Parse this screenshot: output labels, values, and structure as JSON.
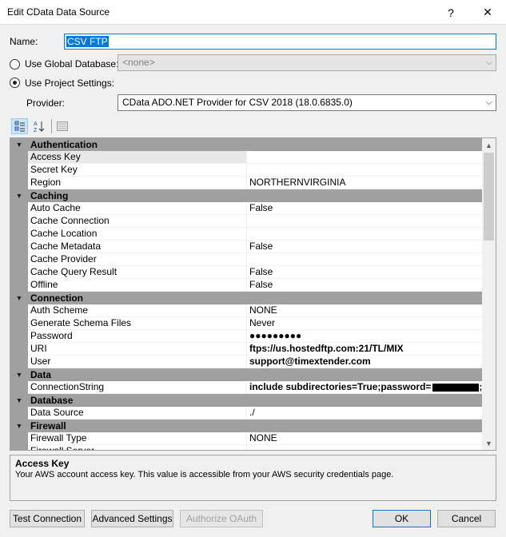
{
  "window": {
    "title": "Edit CData Data Source",
    "help_glyph": "?",
    "close_glyph": "✕"
  },
  "form": {
    "name_label": "Name:",
    "name_value": "CSV FTP",
    "use_global_label": "Use Global Database:",
    "global_db_value": "<none>",
    "use_project_label": "Use Project Settings:",
    "provider_label": "Provider:",
    "provider_value": "CData ADO.NET Provider for CSV 2018 (18.0.6835.0)",
    "selected_mode": "project"
  },
  "toolbar": {
    "categorized_icon": "categorized-icon",
    "alphabetical_icon": "alphabetical-icon",
    "property_pages_icon": "property-pages-icon"
  },
  "property_grid": {
    "categories": [
      {
        "name": "Authentication",
        "properties": [
          {
            "name": "Access Key",
            "value": "",
            "selected": true
          },
          {
            "name": "Secret Key",
            "value": ""
          },
          {
            "name": "Region",
            "value": "NORTHERNVIRGINIA"
          }
        ]
      },
      {
        "name": "Caching",
        "properties": [
          {
            "name": "Auto Cache",
            "value": "False"
          },
          {
            "name": "Cache Connection",
            "value": ""
          },
          {
            "name": "Cache Location",
            "value": ""
          },
          {
            "name": "Cache Metadata",
            "value": "False"
          },
          {
            "name": "Cache Provider",
            "value": ""
          },
          {
            "name": "Cache Query Result",
            "value": "False"
          },
          {
            "name": "Offline",
            "value": "False"
          }
        ]
      },
      {
        "name": "Connection",
        "properties": [
          {
            "name": "Auth Scheme",
            "value": "NONE"
          },
          {
            "name": "Generate Schema Files",
            "value": "Never"
          },
          {
            "name": "Password",
            "value": "●●●●●●●●●",
            "bold": true
          },
          {
            "name": "URI",
            "value": "ftps://us.hostedftp.com:21/TL/MIX",
            "bold": true
          },
          {
            "name": "User",
            "value": "support@timextender.com",
            "bold": true
          }
        ]
      },
      {
        "name": "Data",
        "properties": [
          {
            "name": "ConnectionString",
            "value": "include subdirectories=True;password=",
            "value_suffix": ";u",
            "bold": true,
            "redacted": true
          }
        ]
      },
      {
        "name": "Database",
        "properties": [
          {
            "name": "Data Source",
            "value": "./"
          }
        ]
      },
      {
        "name": "Firewall",
        "properties": [
          {
            "name": "Firewall Type",
            "value": "NONE"
          },
          {
            "name": "Firewall Server",
            "value": ""
          }
        ]
      }
    ]
  },
  "description": {
    "title": "Access Key",
    "text": "Your AWS account access key. This value is accessible from your AWS security credentials page."
  },
  "buttons": {
    "test_connection": "Test Connection",
    "advanced_settings": "Advanced Settings",
    "authorize_oauth": "Authorize OAuth",
    "ok": "OK",
    "cancel": "Cancel"
  }
}
